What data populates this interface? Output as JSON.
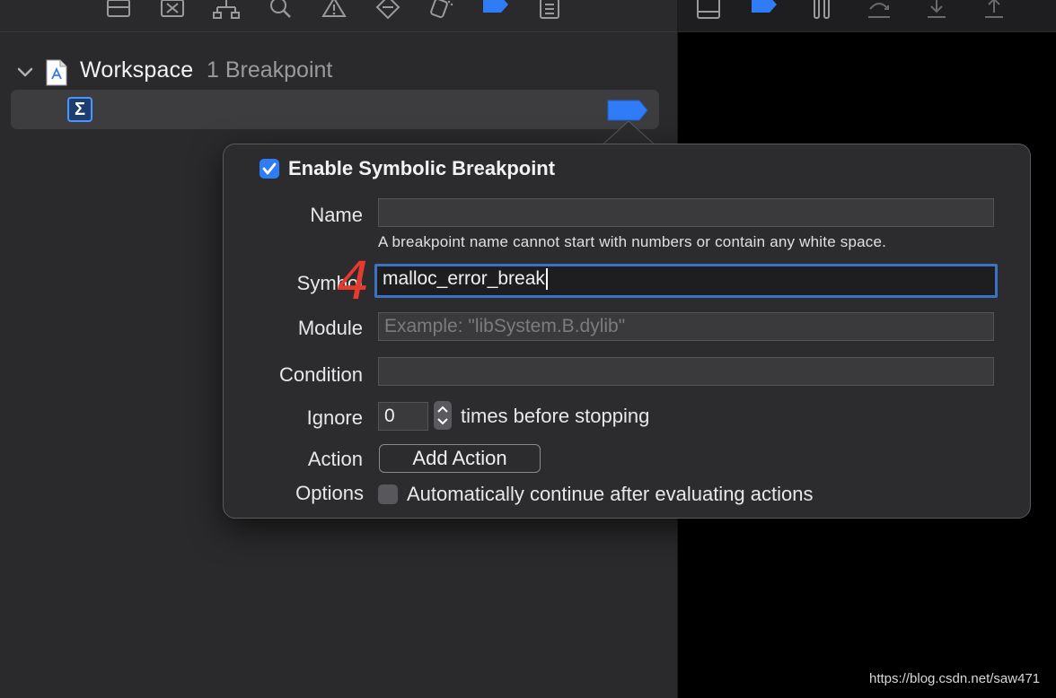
{
  "toolbar": {
    "icons": [
      "panel-icon",
      "debug-icon",
      "hierarchy-icon",
      "search-icon",
      "warning-icon",
      "test-icon",
      "debug-nav-icon",
      "breakpoint-nav-icon",
      "report-icon"
    ]
  },
  "right_toolbar": {
    "icons": [
      "panel-icon",
      "breakpoint-toggle-icon",
      "pause-icon",
      "step-over-icon",
      "step-into-icon",
      "step-out-icon"
    ]
  },
  "navigator": {
    "workspace_title": "Workspace",
    "workspace_count": "1 Breakpoint"
  },
  "popover": {
    "enable_label": "Enable Symbolic Breakpoint",
    "enabled": true,
    "name_label": "Name",
    "name_value": "",
    "name_hint": "A breakpoint name cannot start with numbers or contain any white space.",
    "symbol_label": "Symbol",
    "symbol_value": "malloc_error_break",
    "module_label": "Module",
    "module_placeholder": "Example: \"libSystem.B.dylib\"",
    "condition_label": "Condition",
    "condition_value": "",
    "ignore_label": "Ignore",
    "ignore_value": "0",
    "ignore_suffix": "times before stopping",
    "action_label": "Action",
    "add_action_label": "Add Action",
    "options_label": "Options",
    "options_text": "Automatically continue after evaluating actions",
    "options_checked": false
  },
  "annotation": {
    "step_number": "4",
    "color": "#e53b2f"
  },
  "watermark": "https://blog.csdn.net/saw471",
  "colors": {
    "accent": "#2f7cf6",
    "breakpoint": "#2f7cf6"
  }
}
